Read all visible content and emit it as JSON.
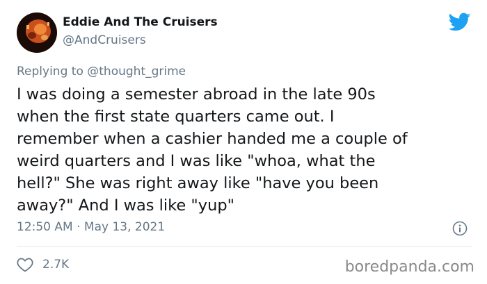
{
  "tweet": {
    "author_name": "Eddie And The Cruisers",
    "author_handle": "@AndCruisers",
    "reply_prefix": "Replying to",
    "reply_to": "@thought_grime",
    "text": "I was doing a semester abroad in the late 90s\nwhen the first state quarters came out. I\nremember when a cashier handed me a couple of\nweird quarters and I was like \"whoa, what the\nhell?\" She was right away like \"have you been\naway?\" And I was like \"yup\"",
    "timestamp": "12:50 AM · May 13, 2021",
    "like_count": "2.7K"
  },
  "icons": {
    "platform": "twitter-bird-icon",
    "info": "info-icon",
    "like": "heart-icon"
  },
  "colors": {
    "brand": "#1da1f2",
    "text": "#14171a",
    "secondary": "#657786"
  },
  "watermark": "boredpanda.com"
}
